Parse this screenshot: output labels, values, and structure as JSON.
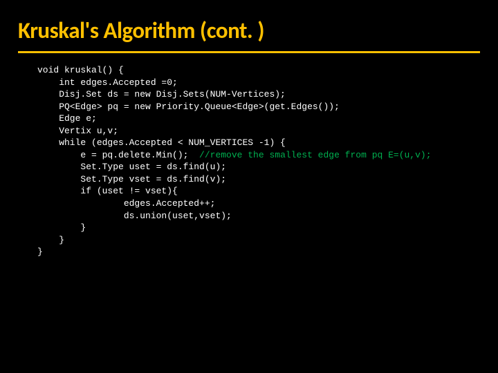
{
  "title": "Kruskal's Algorithm (cont. )",
  "code": {
    "l1": "void kruskal() {",
    "l2": "    int edges.Accepted =0;",
    "l3": "    Disj.Set ds = new Disj.Sets(NUM-Vertices);",
    "l4": "    PQ<Edge> pq = new Priority.Queue<Edge>(get.Edges());",
    "l5": "    Edge e;",
    "l6": "    Vertix u,v;",
    "l7": "    while (edges.Accepted < NUM_VERTICES -1) {",
    "l8a": "        e = pq.delete.Min();  ",
    "l8b": "//remove the smallest edge from pq E=(u,v);",
    "l9": "        Set.Type uset = ds.find(u);",
    "l10": "        Set.Type vset = ds.find(v);",
    "l11": "        if (uset != vset){",
    "l12": "                edges.Accepted++;",
    "l13": "                ds.union(uset,vset);",
    "l14": "        }",
    "l15": "    }",
    "l16": "}"
  }
}
